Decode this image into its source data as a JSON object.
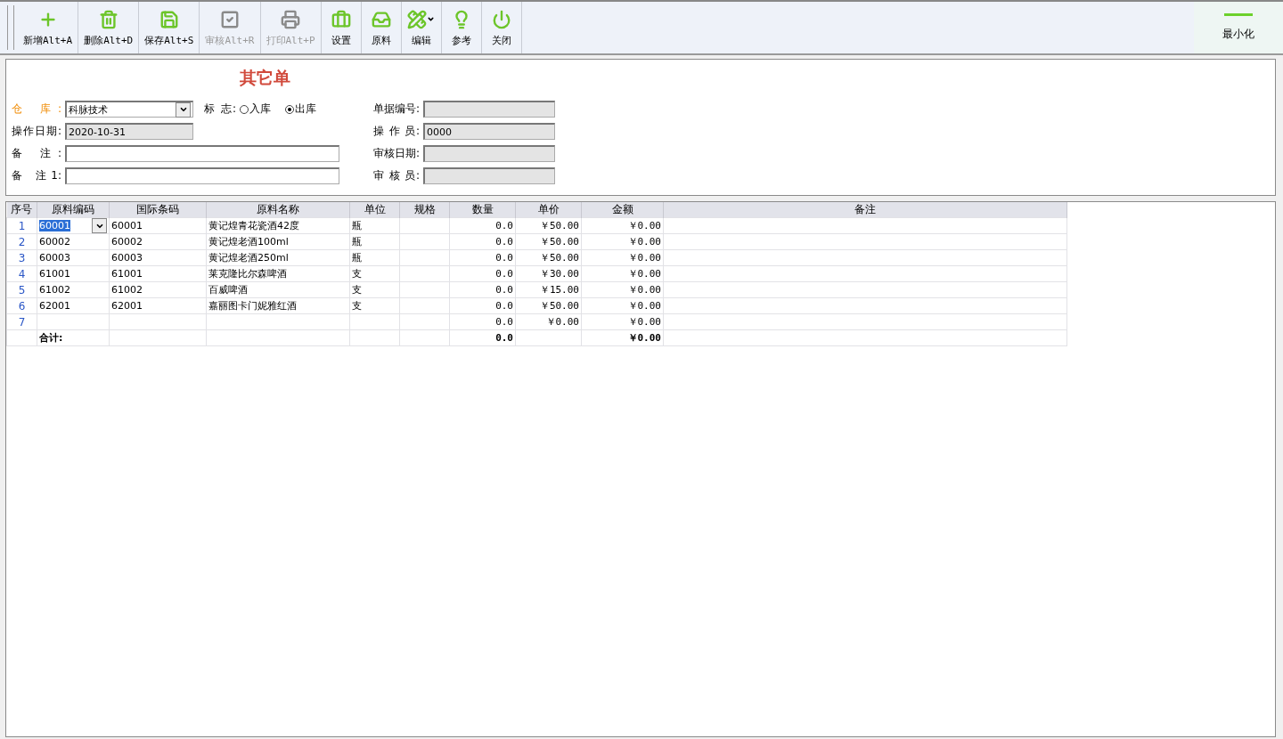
{
  "toolbar": {
    "buttons": [
      {
        "label": "新增Alt+A",
        "kind": "add",
        "disabled": false
      },
      {
        "label": "删除Alt+D",
        "kind": "delete",
        "disabled": false
      },
      {
        "label": "保存Alt+S",
        "kind": "save",
        "disabled": false
      },
      {
        "label": "审核Alt+R",
        "kind": "audit",
        "disabled": true
      },
      {
        "label": "打印Alt+P",
        "kind": "print",
        "disabled": true
      },
      {
        "label": "设置",
        "kind": "settings",
        "disabled": false
      },
      {
        "label": "原料",
        "kind": "materials",
        "disabled": false
      },
      {
        "label": "编辑",
        "kind": "edit",
        "disabled": false,
        "has_menu": true
      },
      {
        "label": "参考",
        "kind": "reference",
        "disabled": false
      },
      {
        "label": "关闭",
        "kind": "close",
        "disabled": false
      }
    ],
    "minimize": {
      "label": "最小化"
    }
  },
  "form": {
    "title": "其它单",
    "warehouse": {
      "label": "仓 库:",
      "value": "科脉技术"
    },
    "flag": {
      "label": "标 志:",
      "options": [
        {
          "label": "入库",
          "selected": false
        },
        {
          "label": "出库",
          "selected": true
        }
      ]
    },
    "date": {
      "label": "操作日期:",
      "value": "2020-10-31"
    },
    "note": {
      "label": "备 注:"
    },
    "note1": {
      "label": "备 注1:"
    },
    "right_fields": [
      {
        "label": "单据编号:"
      },
      {
        "label": "操 作 员:",
        "value": "0000"
      },
      {
        "label": "审核日期:"
      },
      {
        "label": "审 核 员:"
      }
    ]
  },
  "table": {
    "columns": [
      "序号",
      "原料编码",
      "国际条码",
      "原料名称",
      "单位",
      "规格",
      "数量",
      "单价",
      "金额",
      "备注"
    ],
    "rows": [
      {
        "no": "1",
        "code": "60001",
        "barcode": "60001",
        "name": "黄记煌青花瓷酒42度",
        "unit": "瓶",
        "qty": "0.0",
        "price": "￥50.00",
        "amount": "￥0.00",
        "editing": true
      },
      {
        "no": "2",
        "code": "60002",
        "barcode": "60002",
        "name": "黄记煌老酒100ml",
        "unit": "瓶",
        "qty": "0.0",
        "price": "￥50.00",
        "amount": "￥0.00",
        "editing": false
      },
      {
        "no": "3",
        "code": "60003",
        "barcode": "60003",
        "name": "黄记煌老酒250ml",
        "unit": "瓶",
        "qty": "0.0",
        "price": "￥50.00",
        "amount": "￥0.00",
        "editing": false
      },
      {
        "no": "4",
        "code": "61001",
        "barcode": "61001",
        "name": "莱克隆比尔森啤酒",
        "unit": "支",
        "qty": "0.0",
        "price": "￥30.00",
        "amount": "￥0.00",
        "editing": false
      },
      {
        "no": "5",
        "code": "61002",
        "barcode": "61002",
        "name": "百威啤酒",
        "unit": "支",
        "qty": "0.0",
        "price": "￥15.00",
        "amount": "￥0.00",
        "editing": false
      },
      {
        "no": "6",
        "code": "62001",
        "barcode": "62001",
        "name": "嘉丽图卡门妮雅红酒",
        "unit": "支",
        "qty": "0.0",
        "price": "￥50.00",
        "amount": "￥0.00",
        "editing": false
      },
      {
        "no": "7",
        "qty": "0.0",
        "price": "￥0.00",
        "amount": "￥0.00",
        "editing": false
      }
    ],
    "total": {
      "label": "合计:",
      "qty": "0.0",
      "amount": "￥0.00"
    }
  }
}
